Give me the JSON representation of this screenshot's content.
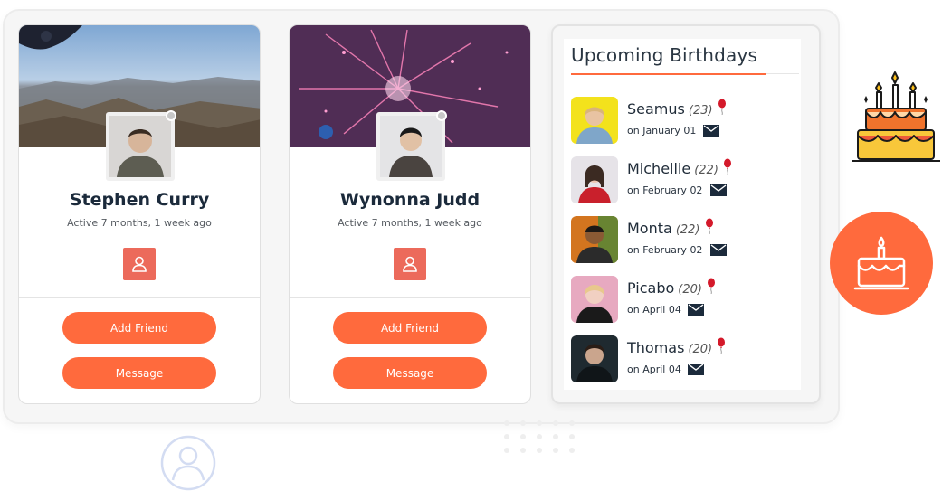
{
  "cards": [
    {
      "name": "Stephen Curry",
      "active": "Active 7 months, 1 week ago",
      "add_friend": "Add Friend",
      "message": "Message"
    },
    {
      "name": "Wynonna Judd",
      "active": "Active 7 months, 1 week ago",
      "add_friend": "Add Friend",
      "message": "Message"
    }
  ],
  "birthdays": {
    "title": "Upcoming Birthdays",
    "items": [
      {
        "name": "Seamus",
        "age": "(23)",
        "date": "on January 01"
      },
      {
        "name": "Michellie",
        "age": "(22)",
        "date": "on February 02"
      },
      {
        "name": "Monta",
        "age": "(22)",
        "date": "on February 02"
      },
      {
        "name": "Picabo",
        "age": "(20)",
        "date": "on April 04"
      },
      {
        "name": "Thomas",
        "age": "(20)",
        "date": "on April 04"
      }
    ]
  },
  "colors": {
    "accent": "#ff6a3d",
    "profile_button": "#ec6a5b",
    "heading": "#1b2a3b"
  },
  "icons": [
    "profile-icon",
    "balloon-icon",
    "mail-icon",
    "birthday-cake-icon",
    "user-outline-icon"
  ]
}
